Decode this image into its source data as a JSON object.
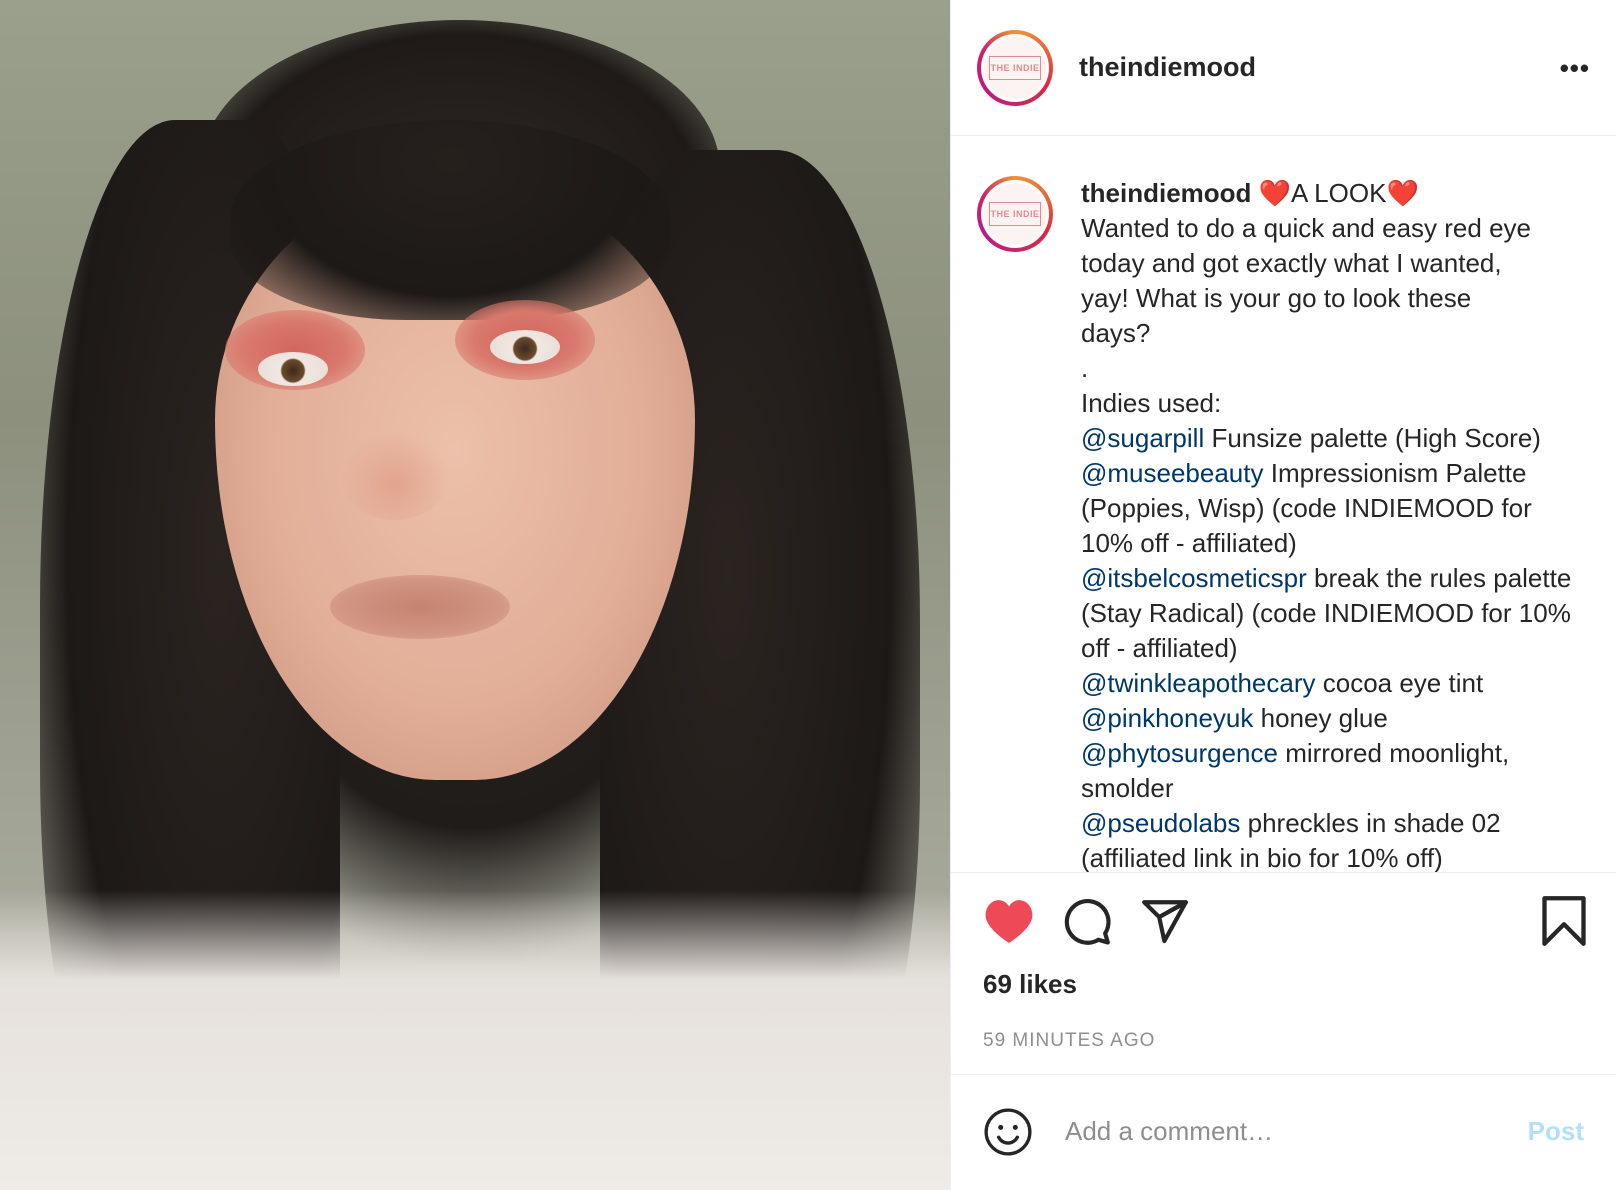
{
  "photo": {
    "description_icon": "selfie-photo"
  },
  "header": {
    "username": "theindiemood",
    "avatar_text": "THE INDIE",
    "more_label": "•••"
  },
  "caption": {
    "username": "theindiemood",
    "heart_emoji": "❤️",
    "title": "A LOOK",
    "lines": [
      "Wanted to do a quick and easy red eye",
      "today and got exactly what I wanted,",
      "yay! What is your go to look these",
      "days?",
      ".",
      "Indies used:"
    ],
    "products": [
      {
        "mention": "@sugarpill",
        "text": " Funsize palette (High Score)"
      },
      {
        "mention": "@museebeauty",
        "text": " Impressionism Palette (Poppies, Wisp) (code INDIEMOOD for 10% off - affiliated)"
      },
      {
        "mention": "@itsbelcosmeticspr",
        "text": " break the rules palette (Stay Radical) (code INDIEMOOD for 10% off - affiliated)"
      },
      {
        "mention": "@twinkleapothecary",
        "text": " cocoa eye tint"
      },
      {
        "mention": "@pinkhoneyuk",
        "text": " honey glue"
      },
      {
        "mention": "@phytosurgence",
        "text": " mirrored moonlight, smolder"
      },
      {
        "mention": "@pseudolabs",
        "text": " phreckles in shade 02 (affiliated link in bio for 10% off)"
      }
    ]
  },
  "actions": {
    "likes": "69 likes",
    "time": "59 MINUTES AGO"
  },
  "comment_box": {
    "placeholder": "Add a comment…",
    "post_label": "Post"
  },
  "colors": {
    "like": "#ed4956",
    "mention": "#00376b",
    "post_disabled": "#b2dffc",
    "muted": "#8e8e8e"
  }
}
